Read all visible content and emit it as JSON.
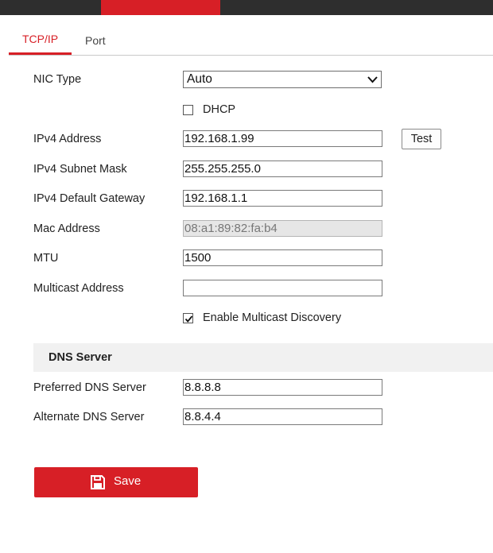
{
  "colors": {
    "accent": "#d71f26",
    "topbar": "#2e2e2e",
    "section_bg": "#f1f1f1"
  },
  "tabs": [
    {
      "label": "TCP/IP",
      "active": true
    },
    {
      "label": "Port",
      "active": false
    }
  ],
  "form": {
    "nic_type": {
      "label": "NIC Type",
      "value": "Auto"
    },
    "dhcp": {
      "label": "DHCP",
      "checked": false
    },
    "ipv4_address": {
      "label": "IPv4 Address",
      "value": "192.168.1.99"
    },
    "test_button": "Test",
    "ipv4_subnet_mask": {
      "label": "IPv4 Subnet Mask",
      "value": "255.255.255.0"
    },
    "ipv4_default_gateway": {
      "label": "IPv4 Default Gateway",
      "value": "192.168.1.1"
    },
    "mac_address": {
      "label": "Mac Address",
      "value": "08:a1:89:82:fa:b4"
    },
    "mtu": {
      "label": "MTU",
      "value": "1500"
    },
    "multicast_address": {
      "label": "Multicast Address",
      "value": ""
    },
    "multicast_discovery": {
      "label": "Enable Multicast Discovery",
      "checked": true
    }
  },
  "dns": {
    "section_title": "DNS Server",
    "preferred": {
      "label": "Preferred DNS Server",
      "value": "8.8.8.8"
    },
    "alternate": {
      "label": "Alternate DNS Server",
      "value": "8.8.4.4"
    }
  },
  "save_button": {
    "label": "Save",
    "icon": "floppy-disk-icon"
  }
}
